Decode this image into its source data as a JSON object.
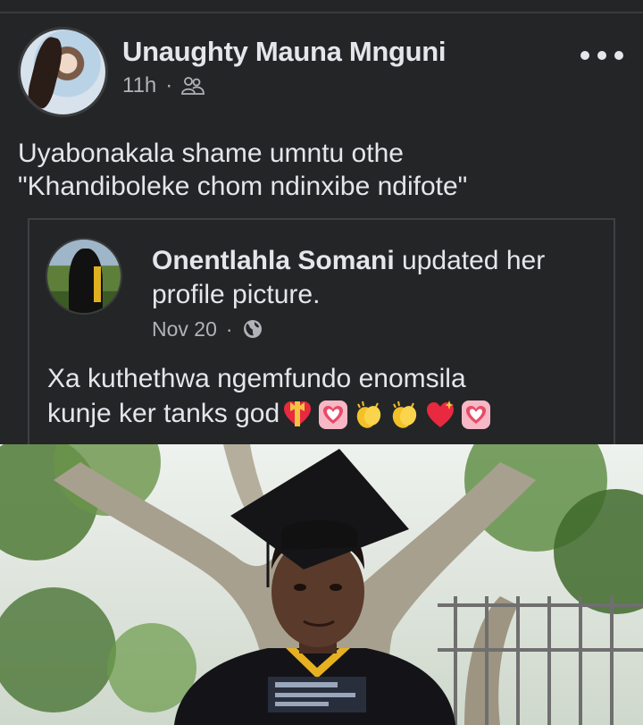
{
  "post": {
    "author": "Unaughty Mauna Mnguni",
    "time": "11h",
    "separator": "·",
    "audience_icon": "friends-icon",
    "more_icon": "more-options-icon",
    "text_line1": "Uyabonakala shame umntu othe",
    "text_line2": "\"Khandiboleke chom ndinxibe ndifote\""
  },
  "shared": {
    "author": "Onentlahla Somani",
    "action": " updated her profile picture.",
    "time": "Nov 20",
    "separator": "·",
    "audience_icon": "globe-icon",
    "text_line1": "Xa kuthethwa  ngemfundo enomsila",
    "text_line2": "kunje ker   tanks god",
    "emojis": [
      "heart-with-ribbon",
      "heart-decoration",
      "clapping-hands",
      "clapping-hands",
      "sparkling-heart",
      "heart-decoration"
    ]
  },
  "photo": {
    "subject": "graduate-photo"
  },
  "colors": {
    "background": "#242526",
    "text": "#e4e6eb",
    "secondary_text": "#b0b3b8",
    "border": "#3e4042"
  }
}
